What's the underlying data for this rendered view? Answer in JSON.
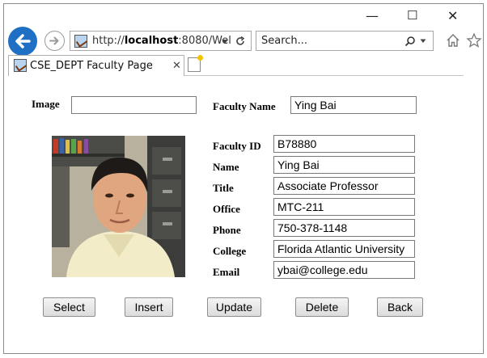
{
  "browser": {
    "url_prefix": "http://",
    "url_host": "localhost",
    "url_rest": ":8080/Wel",
    "search_placeholder": "Search...",
    "tab_title": "CSE_DEPT Faculty Page",
    "win_minimize": "—",
    "win_maximize": "☐",
    "win_close": "✕"
  },
  "form": {
    "image_label": "Image",
    "image_value": "",
    "faculty_name_label": "Faculty Name",
    "faculty_name_value": "Ying Bai",
    "fields": [
      {
        "label": "Faculty ID",
        "value": "B78880"
      },
      {
        "label": "Name",
        "value": "Ying Bai"
      },
      {
        "label": "Title",
        "value": "Associate Professor"
      },
      {
        "label": "Office",
        "value": "MTC-211"
      },
      {
        "label": "Phone",
        "value": "750-378-1148"
      },
      {
        "label": "College",
        "value": "Florida Atlantic University"
      },
      {
        "label": "Email",
        "value": "ybai@college.edu"
      }
    ]
  },
  "buttons": {
    "select": "Select",
    "insert": "Insert",
    "update": "Update",
    "delete": "Delete",
    "back": "Back"
  },
  "colors": {
    "accent": "#1f6fc4"
  }
}
